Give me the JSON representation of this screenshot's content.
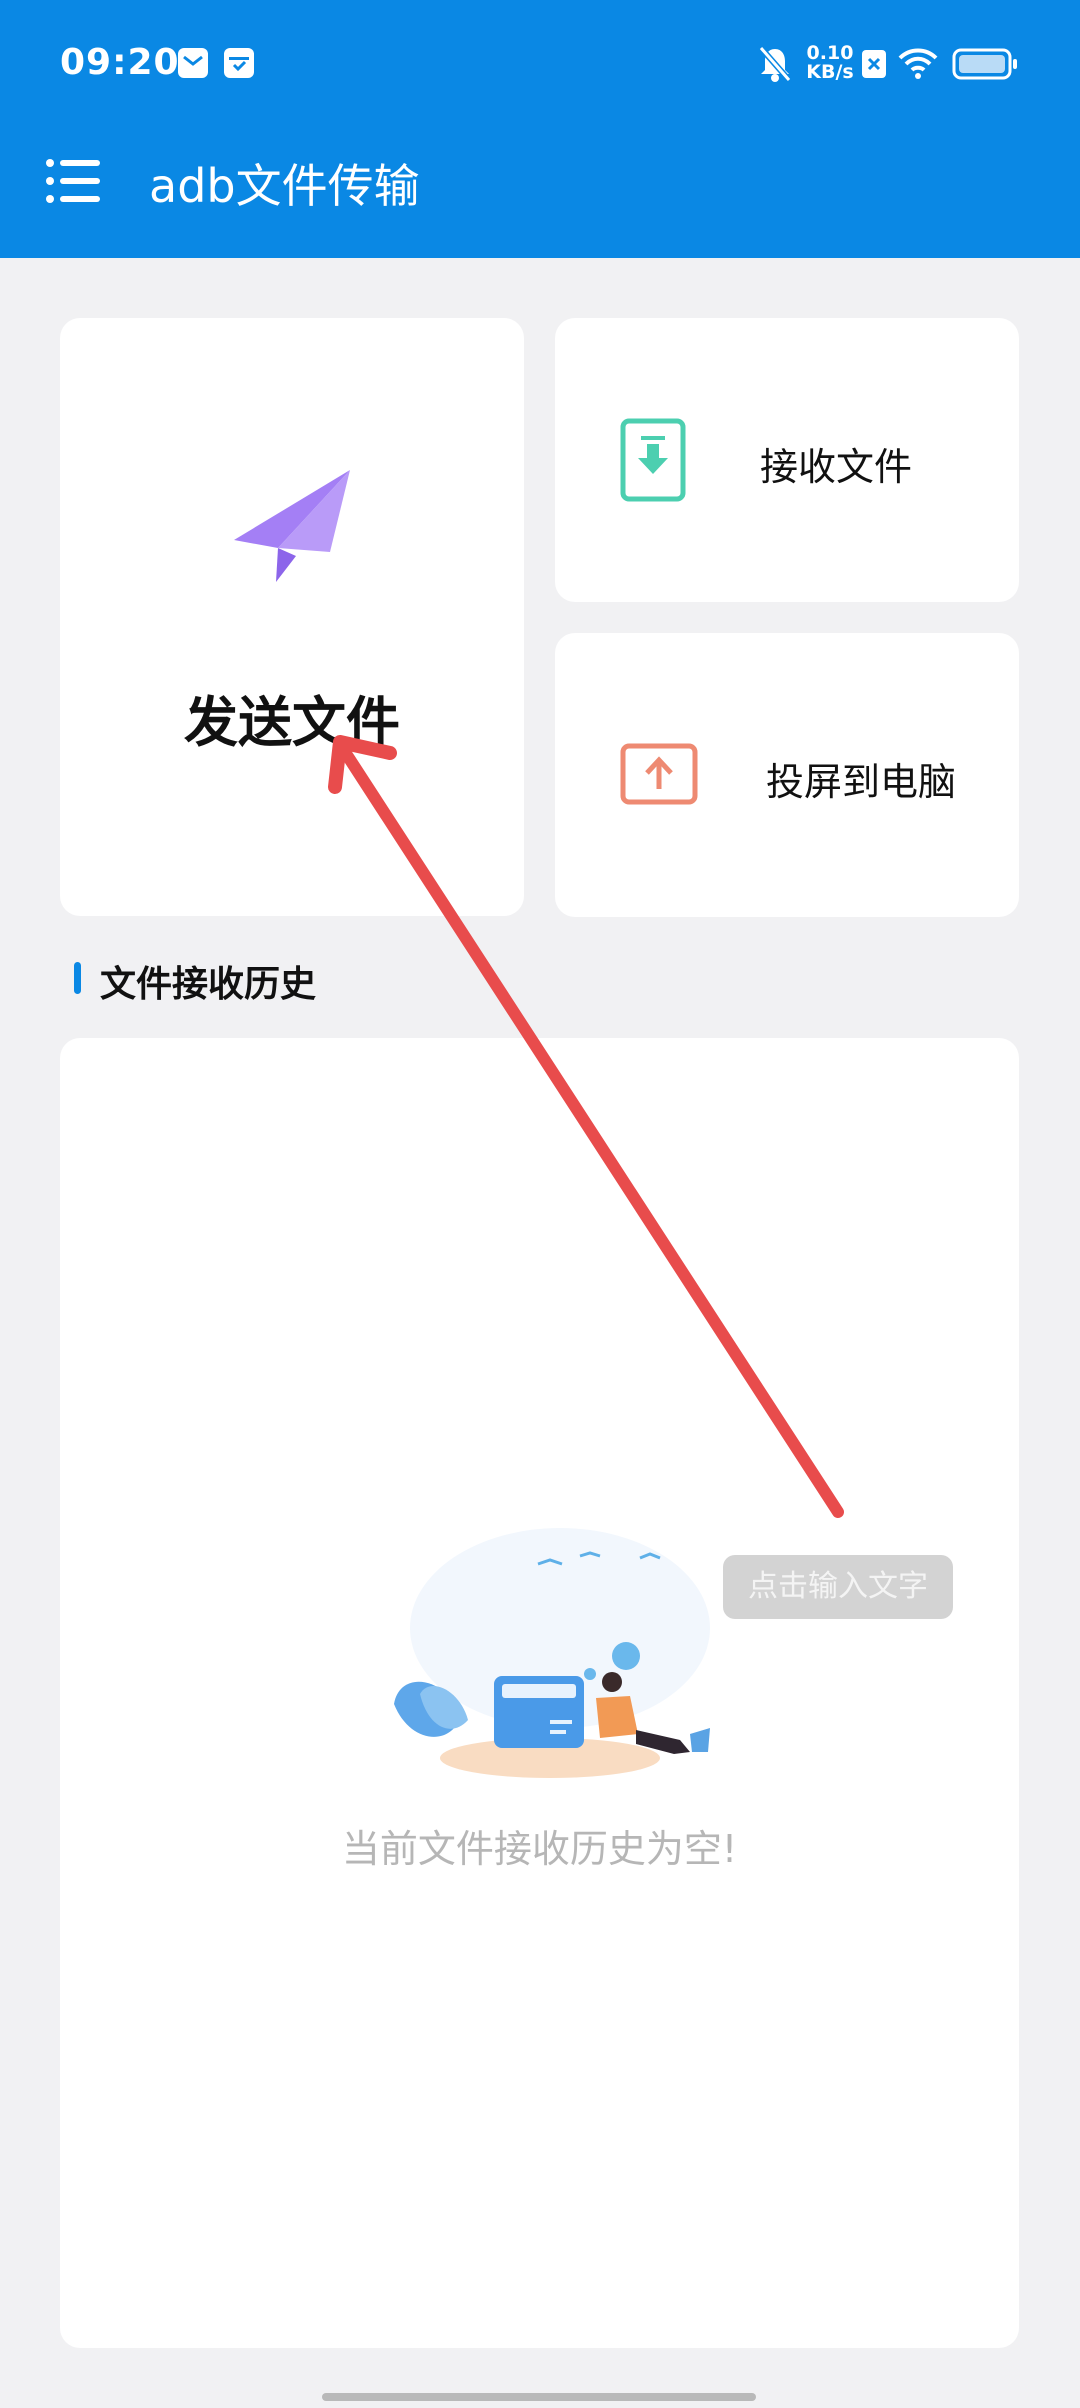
{
  "status_bar": {
    "time": "09:20",
    "net_speed_value": "0.10",
    "net_speed_unit": "KB/s",
    "icons": [
      "mail-icon",
      "box-icon",
      "bell-mute-icon",
      "sim-off-icon",
      "wifi-icon",
      "battery-icon"
    ]
  },
  "app_bar": {
    "title": "adb文件传输",
    "menu_icon": "menu-icon"
  },
  "actions": {
    "send_label": "发送文件",
    "receive_label": "接收文件",
    "cast_label": "投屏到电脑"
  },
  "history": {
    "section_title": "文件接收历史",
    "empty_text": "当前文件接收历史为空!"
  },
  "overlay": {
    "toast_text": "点击输入文字"
  },
  "colors": {
    "primary": "#0a88e4",
    "send_icon": "#a47ff5",
    "receive_icon": "#4ccfb0",
    "cast_icon": "#ee8a72",
    "annotation_arrow": "#e84c4c"
  }
}
